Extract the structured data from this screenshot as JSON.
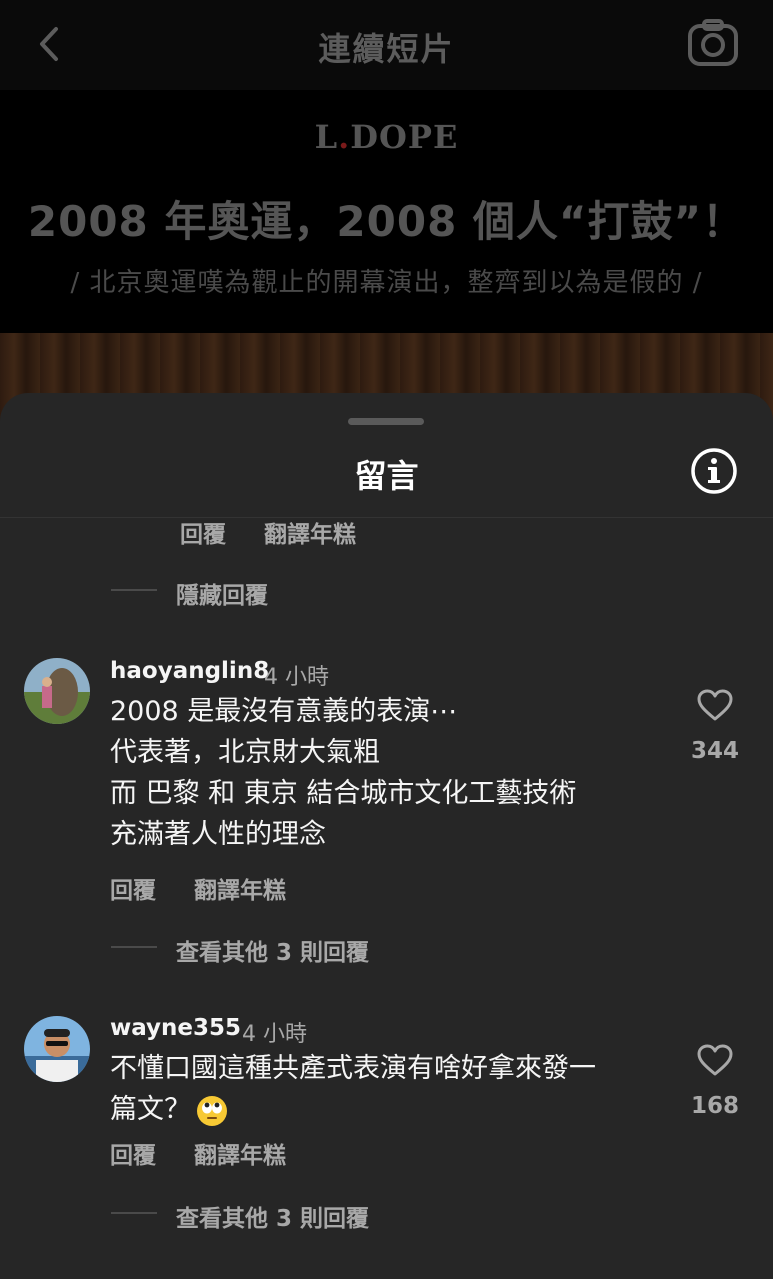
{
  "header": {
    "title": "連續短片",
    "back_icon": "chevron-left-icon",
    "camera_icon": "camera-icon"
  },
  "video": {
    "brand_prefix": "L",
    "brand_dot": ".",
    "brand_suffix": "DOPE",
    "headline": "2008 年奧運，2008 個人“打鼓”！",
    "subline": "/ 北京奧運嘆為觀止的開幕演出，整齊到以為是假的 /"
  },
  "sheet": {
    "title": "留言",
    "info_icon": "info-icon"
  },
  "prev_thread": {
    "reply_label": "回覆",
    "translate_label": "翻譯年糕",
    "hide_replies": "隱藏回覆"
  },
  "comments": [
    {
      "username": "haoyanglin8",
      "time": "4 小時",
      "text": "2008 是最沒有意義的表演⋯\n代表著，北京財大氣粗\n而 巴黎 和 東京 結合城市文化工藝技術\n充滿著人性的理念",
      "likes": "344",
      "reply_label": "回覆",
      "translate_label": "翻譯年糕",
      "view_replies": "查看其他 3 則回覆"
    },
    {
      "username": "wayne355",
      "time": "4 小時",
      "text": "不懂口國這種共產式表演有啥好拿來發一\n篇文？",
      "emoji": "face-with-rolling-eyes",
      "likes": "168",
      "reply_label": "回覆",
      "translate_label": "翻譯年糕",
      "view_replies": "查看其他 3 則回覆"
    }
  ]
}
